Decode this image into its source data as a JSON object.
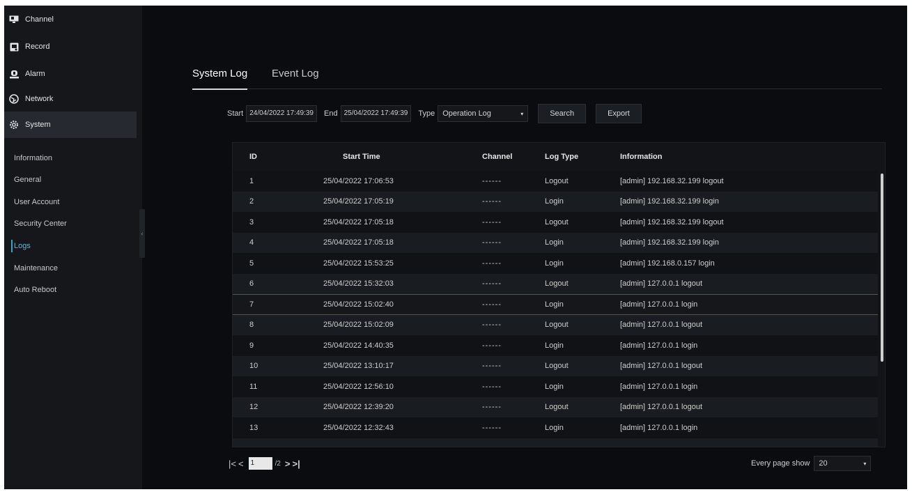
{
  "sidebar": {
    "main_items": [
      {
        "label": "Channel",
        "icon": "monitor-icon"
      },
      {
        "label": "Record",
        "icon": "record-icon"
      },
      {
        "label": "Alarm",
        "icon": "alarm-icon"
      },
      {
        "label": "Network",
        "icon": "network-icon"
      },
      {
        "label": "System",
        "icon": "gear-icon"
      }
    ],
    "sub_items": [
      {
        "label": "Information"
      },
      {
        "label": "General"
      },
      {
        "label": "User Account"
      },
      {
        "label": "Security Center"
      },
      {
        "label": "Logs"
      },
      {
        "label": "Maintenance"
      },
      {
        "label": "Auto Reboot"
      }
    ],
    "active_main": "System",
    "active_sub": "Logs"
  },
  "tabs": [
    {
      "label": "System Log"
    },
    {
      "label": "Event Log"
    }
  ],
  "filters": {
    "start_label": "Start",
    "start_value": "24/04/2022 17:49:39",
    "end_label": "End",
    "end_value": "25/04/2022 17:49:39",
    "type_label": "Type",
    "type_value": "Operation Log",
    "search_label": "Search",
    "export_label": "Export"
  },
  "table": {
    "headers": {
      "id": "ID",
      "start_time": "Start Time",
      "channel": "Channel",
      "log_type": "Log Type",
      "information": "Information"
    },
    "rows": [
      {
        "id": "1",
        "time": "25/04/2022 17:06:53",
        "channel": "------",
        "type": "Logout",
        "info": "[admin] 192.168.32.199 logout"
      },
      {
        "id": "2",
        "time": "25/04/2022 17:05:19",
        "channel": "------",
        "type": "Login",
        "info": "[admin] 192.168.32.199 login"
      },
      {
        "id": "3",
        "time": "25/04/2022 17:05:18",
        "channel": "------",
        "type": "Logout",
        "info": "[admin] 192.168.32.199 logout"
      },
      {
        "id": "4",
        "time": "25/04/2022 17:05:18",
        "channel": "------",
        "type": "Login",
        "info": "[admin] 192.168.32.199 login"
      },
      {
        "id": "5",
        "time": "25/04/2022 15:53:25",
        "channel": "------",
        "type": "Login",
        "info": "[admin] 192.168.0.157 login"
      },
      {
        "id": "6",
        "time": "25/04/2022 15:32:03",
        "channel": "------",
        "type": "Logout",
        "info": "[admin] 127.0.0.1 logout"
      },
      {
        "id": "7",
        "time": "25/04/2022 15:02:40",
        "channel": "------",
        "type": "Login",
        "info": "[admin] 127.0.0.1 login"
      },
      {
        "id": "8",
        "time": "25/04/2022 15:02:09",
        "channel": "------",
        "type": "Logout",
        "info": "[admin] 127.0.0.1 logout"
      },
      {
        "id": "9",
        "time": "25/04/2022 14:40:35",
        "channel": "------",
        "type": "Login",
        "info": "[admin] 127.0.0.1 login"
      },
      {
        "id": "10",
        "time": "25/04/2022 13:10:17",
        "channel": "------",
        "type": "Logout",
        "info": "[admin] 127.0.0.1 logout"
      },
      {
        "id": "11",
        "time": "25/04/2022 12:56:10",
        "channel": "------",
        "type": "Login",
        "info": "[admin] 127.0.0.1 login"
      },
      {
        "id": "12",
        "time": "25/04/2022 12:39:20",
        "channel": "------",
        "type": "Logout",
        "info": "[admin] 127.0.0.1 logout"
      },
      {
        "id": "13",
        "time": "25/04/2022 12:32:43",
        "channel": "------",
        "type": "Login",
        "info": "[admin] 127.0.0.1 login"
      }
    ],
    "selected_row_id": "7"
  },
  "pagination": {
    "current_page": "1",
    "total_pages": "/2",
    "page_size_label": "Every page show",
    "page_size_value": "20"
  },
  "colors": {
    "background": "#0b0c0f",
    "sidebar": "#15171b",
    "accent": "#3aa3c4"
  }
}
